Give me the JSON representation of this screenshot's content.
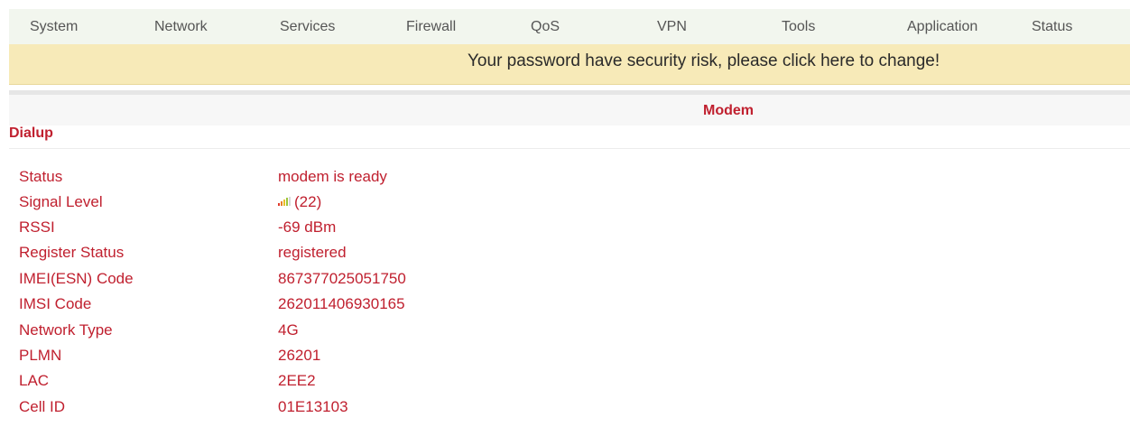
{
  "nav": {
    "items": [
      "System",
      "Network",
      "Services",
      "Firewall",
      "QoS",
      "VPN",
      "Tools",
      "Application",
      "Status"
    ]
  },
  "warning": {
    "text": "Your password have security risk, please click here to change!"
  },
  "section": {
    "title": "Modem"
  },
  "subsection": {
    "title": "Dialup"
  },
  "modem": {
    "rows": [
      {
        "label": "Status",
        "value": "modem is ready"
      },
      {
        "label": "Signal Level",
        "value": "(22)"
      },
      {
        "label": "RSSI",
        "value": "-69 dBm"
      },
      {
        "label": "Register Status",
        "value": "registered"
      },
      {
        "label": "IMEI(ESN) Code",
        "value": "867377025051750"
      },
      {
        "label": "IMSI Code",
        "value": "262011406930165"
      },
      {
        "label": "Network Type",
        "value": "4G"
      },
      {
        "label": "PLMN",
        "value": "26201"
      },
      {
        "label": "LAC",
        "value": "2EE2"
      },
      {
        "label": "Cell ID",
        "value": "01E13103"
      }
    ]
  },
  "colors": {
    "accent": "#c0202f",
    "nav_bg": "#f2f6ee",
    "warning_bg": "#f7eab8"
  },
  "icons": {
    "signal": "signal-bars-icon"
  }
}
